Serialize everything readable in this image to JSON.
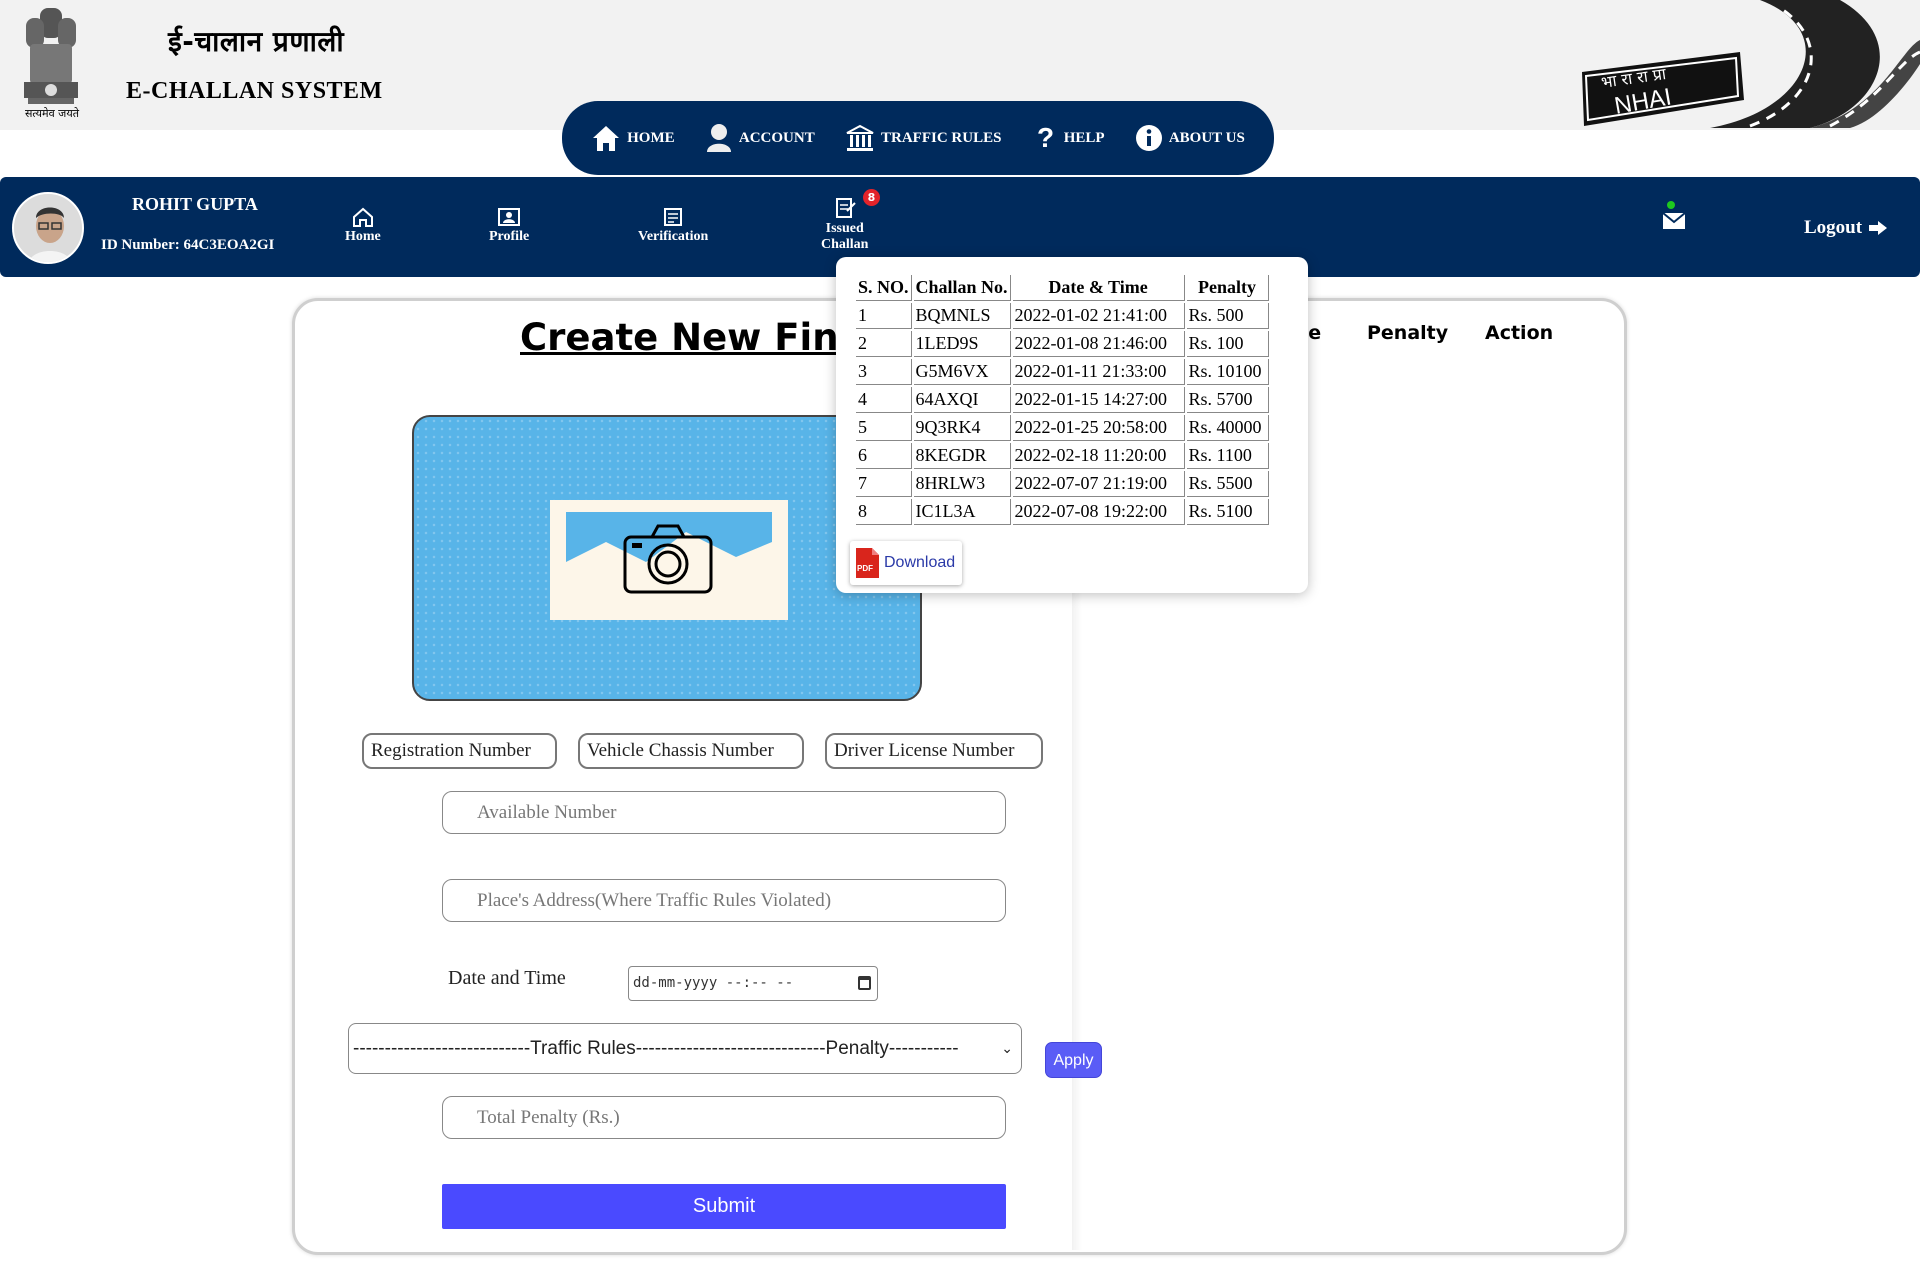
{
  "header": {
    "title_hindi": "ई-चालान प्रणाली",
    "title_en": "E-CHALLAN SYSTEM",
    "emblem_motto": "सत्यमेव जयते",
    "nhai_text": "NHAI",
    "nhai_hindi": "भा रा रा प्रा"
  },
  "top_nav": {
    "items": [
      {
        "label": "HOME",
        "icon": "home-icon"
      },
      {
        "label": "ACCOUNT",
        "icon": "user-icon"
      },
      {
        "label": "TRAFFIC RULES",
        "icon": "building-icon"
      },
      {
        "label": "HELP",
        "icon": "question-icon"
      },
      {
        "label": "ABOUT US",
        "icon": "info-icon"
      }
    ]
  },
  "dashboard": {
    "user_name": "ROHIT GUPTA",
    "user_id": "ID Number: 64C3EOA2GI",
    "nav": [
      {
        "label": "Home",
        "icon": "home-outline-icon"
      },
      {
        "label": "Profile",
        "icon": "id-card-icon"
      },
      {
        "label": "Verification",
        "icon": "document-icon"
      },
      {
        "label_line1": "Issued",
        "label_line2": "Challan",
        "icon": "challan-icon",
        "badge": "8"
      }
    ],
    "logout_label": "Logout"
  },
  "form": {
    "title": "Create New Fine",
    "id_options": [
      "Registration Number",
      "Vehicle Chassis Number",
      "Driver License Number"
    ],
    "available_number_placeholder": "Available Number",
    "address_placeholder": "Place's Address(Where Traffic Rules Violated)",
    "date_time_label": "Date and Time",
    "date_time_placeholder": "dd-mm-yyyy --:-- --",
    "traffic_select": "----------------------------Traffic Rules------------------------------Penalty-----------",
    "apply_label": "Apply",
    "total_penalty_placeholder": "Total Penalty (Rs.)",
    "submit_label": "Submit"
  },
  "right_panel": {
    "headers": [
      "ce",
      "Penalty",
      "Action"
    ]
  },
  "challan_popup": {
    "columns": [
      "S. NO.",
      "Challan No.",
      "Date & Time",
      "Penalty"
    ],
    "rows": [
      [
        "1",
        "BQMNLS",
        "2022-01-02 21:41:00",
        "Rs. 500"
      ],
      [
        "2",
        "1LED9S",
        "2022-01-08 21:46:00",
        "Rs. 100"
      ],
      [
        "3",
        "G5M6VX",
        "2022-01-11 21:33:00",
        "Rs. 10100"
      ],
      [
        "4",
        "64AXQI",
        "2022-01-15 14:27:00",
        "Rs. 5700"
      ],
      [
        "5",
        "9Q3RK4",
        "2022-01-25 20:58:00",
        "Rs. 40000"
      ],
      [
        "6",
        "8KEGDR",
        "2022-02-18 11:20:00",
        "Rs. 1100"
      ],
      [
        "7",
        "8HRLW3",
        "2022-07-07 21:19:00",
        "Rs. 5500"
      ],
      [
        "8",
        "IC1L3A",
        "2022-07-08 19:22:00",
        "Rs. 5100"
      ]
    ],
    "download_label": "Download",
    "pdf_label": "PDF"
  },
  "colors": {
    "navy": "#002a5c",
    "submit_blue": "#4a4aff",
    "apply_purple": "#5a5cf6",
    "badge_red": "#e2232a",
    "photo_blue": "#58b4e8"
  }
}
